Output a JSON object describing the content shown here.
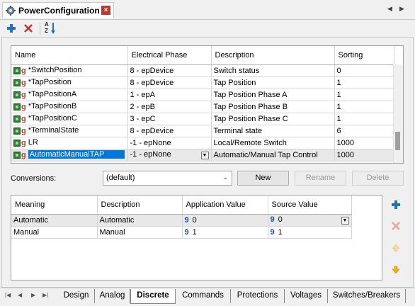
{
  "title_tab": {
    "title": "PowerConfiguration",
    "close_icon": "×"
  },
  "nav": {
    "left": "◀",
    "right": "▶"
  },
  "toolbar": {
    "add_icon": "plus-icon",
    "delete_icon": "x-icon",
    "sort_icon": "sort-az-icon",
    "sort_top": "A",
    "sort_bottom": "Z"
  },
  "grid1": {
    "columns": [
      "Name",
      "Electrical Phase",
      "Description",
      "Sorting"
    ],
    "rows": [
      {
        "name": "*SwitchPosition",
        "phase": "8 - epDevice",
        "description": "Switch status",
        "sorting": "0"
      },
      {
        "name": "*TapPosition",
        "phase": "8 - epDevice",
        "description": "Tap Position",
        "sorting": "1"
      },
      {
        "name": "*TapPositionA",
        "phase": "1 - epA",
        "description": "Tap Position Phase A",
        "sorting": "1"
      },
      {
        "name": "*TapPositionB",
        "phase": "2 - epB",
        "description": "Tap Position Phase B",
        "sorting": "1"
      },
      {
        "name": "*TapPositionC",
        "phase": "3 - epC",
        "description": "Tap Position Phase C",
        "sorting": "1"
      },
      {
        "name": "*TerminalState",
        "phase": "8 - epDevice",
        "description": "Terminal state",
        "sorting": "6"
      },
      {
        "name": "LR",
        "phase": "-1 - epNone",
        "description": "Local/Remote Switch",
        "sorting": "1000"
      },
      {
        "name": "AutomaticManualTAP",
        "phase": "-1 - epNone",
        "description": "Automatic/Manual Tap Control",
        "sorting": "1000"
      }
    ],
    "row_icon_glyph": "g"
  },
  "conversions": {
    "label": "Conversions:",
    "selected": "(default)",
    "buttons": {
      "new": "New",
      "rename": "Rename",
      "delete": "Delete"
    }
  },
  "grid2": {
    "columns": [
      "Meaning",
      "Description",
      "Application Value",
      "Source Value"
    ],
    "rows": [
      {
        "meaning": "Automatic",
        "description": "Automatic",
        "app_value": "0",
        "source_value": "0"
      },
      {
        "meaning": "Manual",
        "description": "Manual",
        "app_value": "1",
        "source_value": "1"
      }
    ],
    "value_glyph": "9"
  },
  "bottom_tabs": [
    "Design",
    "Analog",
    "Discrete",
    "Commands",
    "Protections",
    "Voltages",
    "Switches/Breakers"
  ],
  "active_tab": "Discrete",
  "colors": {
    "accent": "#0078d7",
    "add": "#1e73be",
    "delete": "#c0392b",
    "icon_green": "#2e7d32",
    "arrow_gold": "#f0b400"
  }
}
